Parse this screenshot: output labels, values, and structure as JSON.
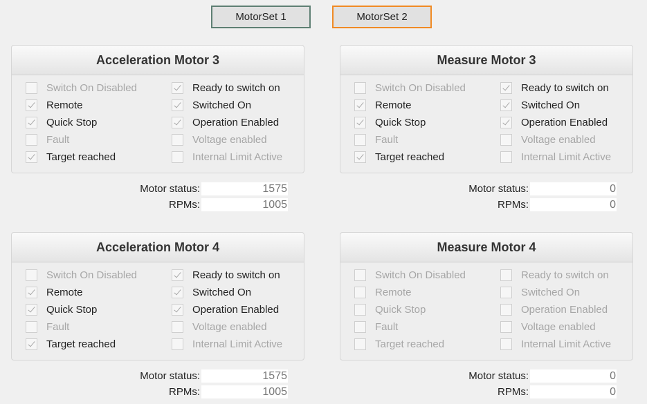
{
  "tabs": [
    {
      "label": "MotorSet 1",
      "selected": true
    },
    {
      "label": "MotorSet 2",
      "selected": false
    }
  ],
  "colors": {
    "tab_selected_border": "#5e7f73",
    "tab_hover_border": "#f08a24",
    "panel_background": "#eeeeee",
    "active_text": "#222222",
    "inactive_text": "#a6a6a6"
  },
  "labels": {
    "motor_status": "Motor status:",
    "rpms": "RPMs:"
  },
  "flag_labels": [
    "Switch On Disabled",
    "Ready to switch on",
    "Remote",
    "Switched On",
    "Quick Stop",
    "Operation Enabled",
    "Fault",
    "Voltage enabled",
    "Target reached",
    "Internal Limit Active"
  ],
  "panels": [
    {
      "title": "Acceleration Motor 3",
      "motor_status": "1575",
      "rpms": "1005",
      "flags": [
        false,
        true,
        true,
        true,
        true,
        true,
        false,
        false,
        true,
        false
      ]
    },
    {
      "title": "Measure Motor 3",
      "motor_status": "0",
      "rpms": "0",
      "flags": [
        false,
        true,
        true,
        true,
        true,
        true,
        false,
        false,
        true,
        false
      ]
    },
    {
      "title": "Acceleration Motor 4",
      "motor_status": "1575",
      "rpms": "1005",
      "flags": [
        false,
        true,
        true,
        true,
        true,
        true,
        false,
        false,
        true,
        false
      ]
    },
    {
      "title": "Measure Motor 4",
      "motor_status": "0",
      "rpms": "0",
      "flags": [
        false,
        false,
        false,
        false,
        false,
        false,
        false,
        false,
        false,
        false
      ]
    }
  ]
}
